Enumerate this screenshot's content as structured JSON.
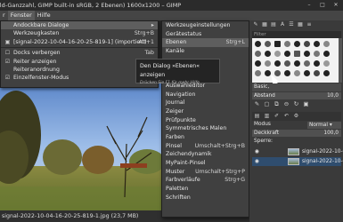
{
  "title": "ild-Ganzzahl, GIMP built-in sRGB, 2 Ebenen) 1600x1200 – GIMP",
  "window_controls": [
    "–",
    "□",
    "✕"
  ],
  "menubar": [
    "r",
    "Fenster",
    "Hilfe"
  ],
  "fenster_menu": [
    {
      "label": "Andockbare Dialoge",
      "accel": "▸",
      "icon": ""
    },
    {
      "label": "Werkzeugkasten",
      "accel": "Strg+B",
      "icon": ""
    },
    {
      "label": "[signal-2022-10-04-16-20-25-819-1] (importiert)",
      "accel": "Alt+1",
      "icon": "▣"
    },
    {
      "label": "Docks verbergen",
      "accel": "Tab",
      "icon": "☐"
    },
    {
      "label": "Reiter anzeigen",
      "accel": "",
      "icon": "☑"
    },
    {
      "label": "Reiteranordnung",
      "accel": "▸",
      "icon": ""
    },
    {
      "label": "Einzelfenster-Modus",
      "accel": "",
      "icon": "☑"
    }
  ],
  "dialogs_menu": [
    {
      "label": "Werkzeugeinstellungen",
      "accel": ""
    },
    {
      "label": "Gerätestatus",
      "accel": ""
    },
    {
      "label": "Ebenen",
      "accel": "Strg+L"
    },
    {
      "label": "Kanäle",
      "accel": ""
    },
    {
      "label": "",
      "accel": ""
    },
    {
      "label": "",
      "accel": ""
    },
    {
      "label": "",
      "accel": ""
    },
    {
      "label": "Auswahleditor",
      "accel": ""
    },
    {
      "label": "Navigation",
      "accel": ""
    },
    {
      "label": "Journal",
      "accel": ""
    },
    {
      "label": "Zeiger",
      "accel": ""
    },
    {
      "label": "Prüfpunkte",
      "accel": ""
    },
    {
      "label": "Symmetrisches Malen",
      "accel": ""
    },
    {
      "label": "Farben",
      "accel": ""
    },
    {
      "label": "Pinsel",
      "accel": "Umschalt+Strg+B"
    },
    {
      "label": "Zeichendynamik",
      "accel": ""
    },
    {
      "label": "MyPaint-Pinsel",
      "accel": ""
    },
    {
      "label": "Muster",
      "accel": "Umschalt+Strg+P"
    },
    {
      "label": "Farbverläufe",
      "accel": "Strg+G"
    },
    {
      "label": "Paletten",
      "accel": ""
    },
    {
      "label": "Schriften",
      "accel": ""
    }
  ],
  "tooltip": {
    "text": "Den Dialog »Ebenen« anzeigen",
    "hint": "Drücken Sie F1 für mehr Hilfe"
  },
  "status": "signal-2022-10-04-16-20-25-819-1.jpg (23,7 MB)",
  "right_panel": {
    "filter_placeholder": "Filter",
    "tag": "Basic,",
    "abstand_label": "Abstand",
    "abstand_value": "10,0",
    "modus_label": "Modus",
    "modus_value": "Normal ▾",
    "deckkraft_label": "Deckkraft",
    "deckkraft_value": "100,0",
    "sperre_label": "Sperre:",
    "layers": [
      {
        "name": "signal-2022-10-04",
        "selected": false
      },
      {
        "name": "signal-2022-10-04",
        "selected": true
      }
    ]
  }
}
